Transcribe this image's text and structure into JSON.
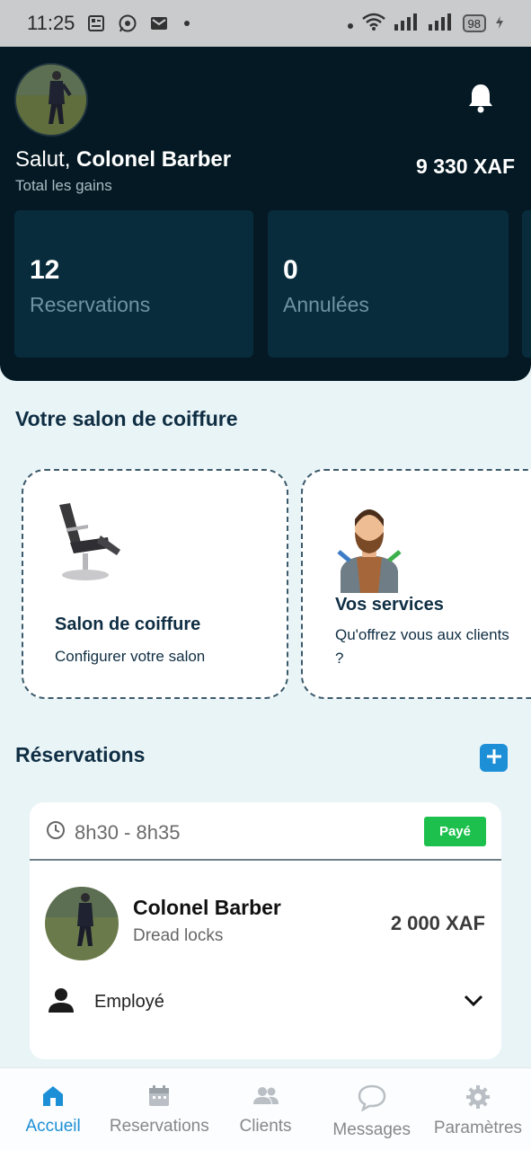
{
  "status_bar": {
    "time": "11:25",
    "battery": "98"
  },
  "header": {
    "greeting_prefix": "Salut, ",
    "user_name": "Colonel Barber",
    "subtitle": "Total les gains",
    "total_earnings": "9 330 XAF",
    "stats": [
      {
        "value": "12",
        "label": "Reservations"
      },
      {
        "value": "0",
        "label": "Annulées"
      }
    ]
  },
  "salon_section": {
    "title": "Votre salon de coiffure",
    "cards": [
      {
        "title": "Salon de coiffure",
        "description": "Configurer votre salon",
        "icon": "barber-chair-icon"
      },
      {
        "title": "Vos services",
        "description": "Qu'offrez vous aux clients ?",
        "icon": "barber-person-icon"
      }
    ]
  },
  "reservations_section": {
    "title": "Réservations",
    "items": [
      {
        "time": "8h30 - 8h35",
        "status": "Payé",
        "client_name": "Colonel Barber",
        "service": "Dread locks",
        "price": "2 000 XAF",
        "employee_label": "Employé"
      }
    ]
  },
  "bottom_nav": {
    "items": [
      {
        "label": "Accueil",
        "icon": "home-icon",
        "active": true
      },
      {
        "label": "Reservations",
        "icon": "calendar-icon",
        "active": false
      },
      {
        "label": "Clients",
        "icon": "users-icon",
        "active": false
      },
      {
        "label": "Messages",
        "icon": "chat-icon",
        "active": false
      },
      {
        "label": "Paramètres",
        "icon": "gear-icon",
        "active": false
      }
    ]
  },
  "colors": {
    "header_bg": "#041923",
    "stat_card_bg": "#092c3d",
    "accent": "#1d8fd6",
    "paid_green": "#1dc04d"
  }
}
